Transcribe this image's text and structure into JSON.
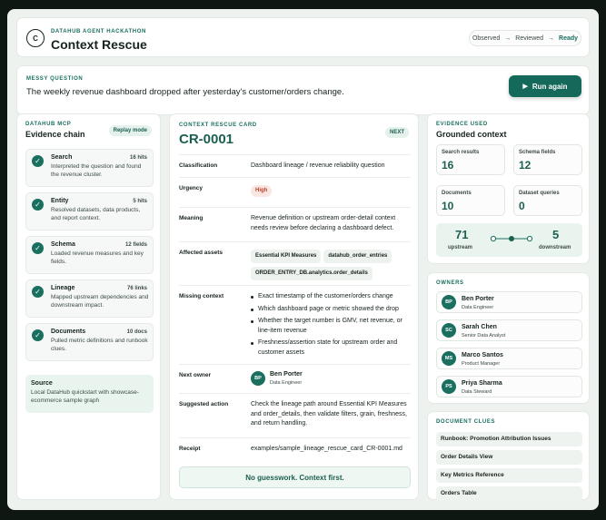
{
  "header": {
    "logo_letter": "C",
    "eyebrow": "DATAHUB AGENT HACKATHON",
    "title": "Context Rescue",
    "steps": [
      "Observed",
      "Reviewed",
      "Ready"
    ],
    "active_step": "Ready"
  },
  "question": {
    "eyebrow": "MESSY QUESTION",
    "text": "The weekly revenue dashboard dropped after yesterday's customer/orders change.",
    "run_label": "Run again"
  },
  "evidence_chain": {
    "eyebrow": "DATAHUB MCP",
    "title": "Evidence chain",
    "mode_label": "Replay mode",
    "steps": [
      {
        "name": "Search",
        "count": "16 hits",
        "desc": "Interpreted the question and found the revenue cluster."
      },
      {
        "name": "Entity",
        "count": "5 hits",
        "desc": "Resolved datasets, data products, and report context."
      },
      {
        "name": "Schema",
        "count": "12 fields",
        "desc": "Loaded revenue measures and key fields."
      },
      {
        "name": "Lineage",
        "count": "76 links",
        "desc": "Mapped upstream dependencies and downstream impact."
      },
      {
        "name": "Documents",
        "count": "10 docs",
        "desc": "Pulled metric definitions and runbook clues."
      }
    ],
    "source": {
      "label": "Source",
      "desc": "Local DataHub quickstart with showcase-ecommerce sample graph"
    }
  },
  "rescue_card": {
    "eyebrow": "CONTEXT RESCUE CARD",
    "id": "CR-0001",
    "next_label": "NEXT",
    "classification_label": "Classification",
    "classification": "Dashboard lineage / revenue reliability question",
    "urgency_label": "Urgency",
    "urgency": "High",
    "meaning_label": "Meaning",
    "meaning": "Revenue definition or upstream order-detail context needs review before declaring a dashboard defect.",
    "affected_label": "Affected assets",
    "affected": [
      "Essential KPI Measures",
      "datahub_order_entries",
      "ORDER_ENTRY_DB.analytics.order_details"
    ],
    "missing_label": "Missing context",
    "missing": [
      "Exact timestamp of the customer/orders change",
      "Which dashboard page or metric showed the drop",
      "Whether the target number is GMV, net revenue, or line-item revenue",
      "Freshness/assertion state for upstream order and customer assets"
    ],
    "owner_label": "Next owner",
    "owner": {
      "initials": "BP",
      "name": "Ben Porter",
      "role": "Data Engineer"
    },
    "action_label": "Suggested action",
    "action": "Check the lineage path around Essential KPI Measures and order_details, then validate filters, grain, freshness, and return handling.",
    "receipt_label": "Receipt",
    "receipt": "examples/sample_lineage_rescue_card_CR-0001.md",
    "motto": "No guesswork. Context first."
  },
  "evidence_used": {
    "eyebrow": "EVIDENCE USED",
    "title": "Grounded context",
    "metrics": [
      {
        "label": "Search results",
        "value": "16"
      },
      {
        "label": "Schema fields",
        "value": "12"
      },
      {
        "label": "Documents",
        "value": "10"
      },
      {
        "label": "Dataset queries",
        "value": "0"
      }
    ],
    "upstream": "71",
    "upstream_label": "upstream",
    "downstream": "5",
    "downstream_label": "downstream"
  },
  "owners": {
    "eyebrow": "OWNERS",
    "list": [
      {
        "initials": "BP",
        "name": "Ben Porter",
        "role": "Data Engineer"
      },
      {
        "initials": "SC",
        "name": "Sarah Chen",
        "role": "Senior Data Analyst"
      },
      {
        "initials": "MS",
        "name": "Marco Santos",
        "role": "Product Manager"
      },
      {
        "initials": "PS",
        "name": "Priya Sharma",
        "role": "Data Steward"
      }
    ]
  },
  "clues": {
    "eyebrow": "DOCUMENT CLUES",
    "list": [
      "Runbook: Promotion Attribution Issues",
      "Order Details View",
      "Key Metrics Reference",
      "Orders Table"
    ]
  },
  "colors": {
    "accent": "#1b6f5f",
    "button": "#15695a",
    "high": "#b4432c"
  }
}
